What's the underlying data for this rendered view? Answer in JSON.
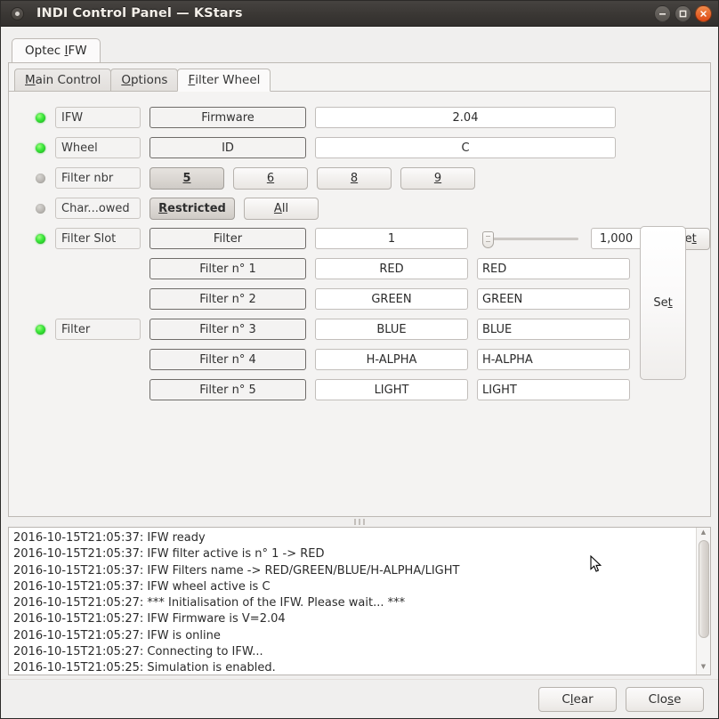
{
  "window": {
    "title": "INDI Control Panel — KStars",
    "menu_icon": "window-menu-icon",
    "minimize_icon": "minimize-icon",
    "maximize_icon": "maximize-icon",
    "close_icon": "close-icon"
  },
  "device_tabs": [
    {
      "label": "Optec IFW",
      "active": true
    }
  ],
  "property_tabs": [
    {
      "pre": "M",
      "post": "ain Control",
      "active": false
    },
    {
      "pre": "O",
      "post": "ptions",
      "active": false
    },
    {
      "pre": "F",
      "post": "ilter Wheel",
      "active": true
    }
  ],
  "rows": {
    "firmware": {
      "led": "on",
      "name": "IFW",
      "label": "Firmware",
      "value": "2.04"
    },
    "id": {
      "led": "on",
      "name": "Wheel",
      "label": "ID",
      "value": "C"
    },
    "filter_nbr": {
      "led": "off",
      "name": "Filter nbr",
      "options": [
        {
          "label": "5",
          "selected": true
        },
        {
          "label": "6",
          "selected": false
        },
        {
          "label": "8",
          "selected": false
        },
        {
          "label": "9",
          "selected": false
        }
      ]
    },
    "char_allowed": {
      "led": "off",
      "name": "Char...owed",
      "options": [
        {
          "pre": "R",
          "post": "estricted",
          "selected": true
        },
        {
          "pre": "A",
          "post": "ll",
          "selected": false
        }
      ]
    },
    "filter_slot": {
      "led": "on",
      "name": "Filter Slot",
      "label": "Filter",
      "value": "1",
      "slider_value": 0,
      "spin_value": "1,000",
      "spin_up_icon": "chevron-up-icon",
      "spin_down_icon": "chevron-down-icon",
      "set_pre": "Se",
      "set_mid": "t",
      "set_post": ""
    },
    "filter_names": {
      "led": "on",
      "name": "Filter",
      "set_pre": "Se",
      "set_mid": "t",
      "items": [
        {
          "label": "Filter n° 1",
          "value": "RED",
          "input": "RED"
        },
        {
          "label": "Filter n° 2",
          "value": "GREEN",
          "input": "GREEN"
        },
        {
          "label": "Filter n° 3",
          "value": "BLUE",
          "input": "BLUE"
        },
        {
          "label": "Filter n° 4",
          "value": "H-ALPHA",
          "input": "H-ALPHA"
        },
        {
          "label": "Filter n° 5",
          "value": "LIGHT",
          "input": "LIGHT"
        }
      ]
    }
  },
  "splitter": {
    "grip_icon": "splitter-grip-icon"
  },
  "log": {
    "scroll_up_icon": "scroll-up-icon",
    "scroll_down_icon": "scroll-down-icon",
    "lines": [
      "2016-10-15T21:05:37: IFW ready",
      "2016-10-15T21:05:37: IFW filter active is n° 1 -> RED",
      "2016-10-15T21:05:37: IFW Filters name -> RED/GREEN/BLUE/H-ALPHA/LIGHT",
      "2016-10-15T21:05:37: IFW wheel active is C",
      "2016-10-15T21:05:27: *** Initialisation of the IFW. Please wait... ***",
      "2016-10-15T21:05:27: IFW Firmware is V=2.04",
      "2016-10-15T21:05:27: IFW is online",
      "2016-10-15T21:05:27: Connecting to IFW...",
      "2016-10-15T21:05:25: Simulation is enabled."
    ]
  },
  "bottom": {
    "clear": {
      "pre": "C",
      "mid": "l",
      "post": "ear"
    },
    "close": {
      "pre": "Clo",
      "mid": "s",
      "post": "e"
    }
  },
  "colors": {
    "led_on": "#3ee83e",
    "led_off": "#b9b6b2",
    "titlebar": "#3a3734",
    "close_button": "#dd4814",
    "panel_bg": "#f4f3f2"
  }
}
